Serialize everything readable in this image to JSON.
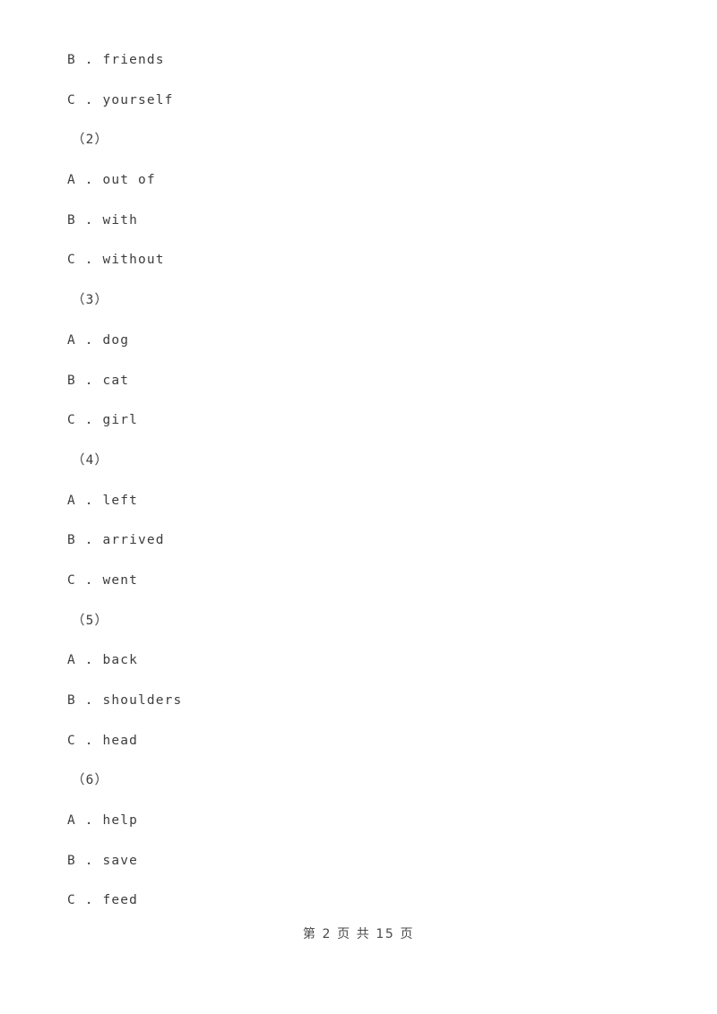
{
  "document": {
    "page_background": "#ffffff",
    "text_color": "#3d3d3d",
    "lines": [
      {
        "kind": "option",
        "text": "B . friends"
      },
      {
        "kind": "option",
        "text": "C . yourself"
      },
      {
        "kind": "qnum",
        "text": "（2）"
      },
      {
        "kind": "option",
        "text": "A . out of"
      },
      {
        "kind": "option",
        "text": "B . with"
      },
      {
        "kind": "option",
        "text": "C . without"
      },
      {
        "kind": "qnum",
        "text": "（3）"
      },
      {
        "kind": "option",
        "text": "A . dog"
      },
      {
        "kind": "option",
        "text": "B . cat"
      },
      {
        "kind": "option",
        "text": "C . girl"
      },
      {
        "kind": "qnum",
        "text": "（4）"
      },
      {
        "kind": "option",
        "text": "A . left"
      },
      {
        "kind": "option",
        "text": "B . arrived"
      },
      {
        "kind": "option",
        "text": "C . went"
      },
      {
        "kind": "qnum",
        "text": "（5）"
      },
      {
        "kind": "option",
        "text": "A . back"
      },
      {
        "kind": "option",
        "text": "B . shoulders"
      },
      {
        "kind": "option",
        "text": "C . head"
      },
      {
        "kind": "qnum",
        "text": "（6）"
      },
      {
        "kind": "option",
        "text": "A . help"
      },
      {
        "kind": "option",
        "text": "B . save"
      },
      {
        "kind": "option",
        "text": "C . feed"
      }
    ]
  },
  "footer": {
    "text": "第 2 页 共 15 页",
    "current_page": "2",
    "total_pages": "15"
  }
}
